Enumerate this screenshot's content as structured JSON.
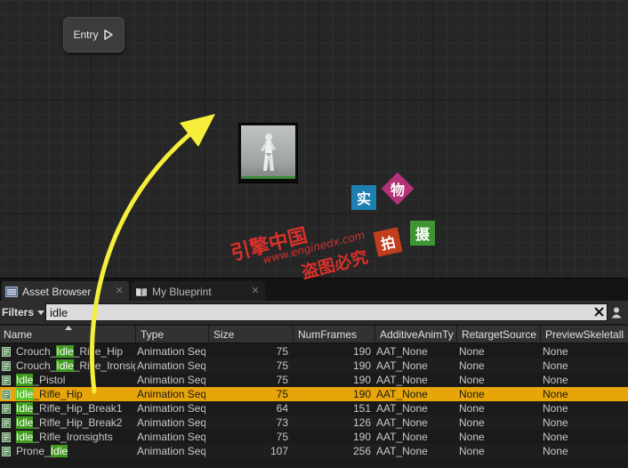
{
  "graph": {
    "entry_label": "Entry"
  },
  "watermark": {
    "sq1": "实",
    "sq2": "物",
    "sq3": "拍",
    "sq4": "摄",
    "line1": "引擎中国",
    "line2": "www.enginedx.com",
    "line3": "盗图必究"
  },
  "tabs": {
    "asset_browser": "Asset Browser",
    "my_blueprint": "My Blueprint",
    "close_glyph": "✕"
  },
  "filter": {
    "label": "Filters",
    "search_value": "idle"
  },
  "columns": [
    "Name",
    "Type",
    "Size",
    "NumFrames",
    "AdditiveAnimTy",
    "RetargetSource",
    "PreviewSkeletall"
  ],
  "rows": [
    {
      "pre": "Crouch_",
      "hl": "Idle",
      "post": "_Rifle_Hip",
      "type": "Animation Seq",
      "size": "75",
      "frames": "190",
      "additive": "AAT_None",
      "retarget": "None",
      "preview": "None",
      "selected": false
    },
    {
      "pre": "Crouch_",
      "hl": "Idle",
      "post": "_Rifle_Ironsig",
      "type": "Animation Seq",
      "size": "75",
      "frames": "190",
      "additive": "AAT_None",
      "retarget": "None",
      "preview": "None",
      "selected": false
    },
    {
      "pre": "",
      "hl": "Idle",
      "post": "_Pistol",
      "type": "Animation Seq",
      "size": "75",
      "frames": "190",
      "additive": "AAT_None",
      "retarget": "None",
      "preview": "None",
      "selected": false
    },
    {
      "pre": "",
      "hl": "Idle",
      "post": "_Rifle_Hip",
      "type": "Animation Seq",
      "size": "75",
      "frames": "190",
      "additive": "AAT_None",
      "retarget": "None",
      "preview": "None",
      "selected": true
    },
    {
      "pre": "",
      "hl": "Idle",
      "post": "_Rifle_Hip_Break1",
      "type": "Animation Seq",
      "size": "64",
      "frames": "151",
      "additive": "AAT_None",
      "retarget": "None",
      "preview": "None",
      "selected": false
    },
    {
      "pre": "",
      "hl": "Idle",
      "post": "_Rifle_Hip_Break2",
      "type": "Animation Seq",
      "size": "73",
      "frames": "126",
      "additive": "AAT_None",
      "retarget": "None",
      "preview": "None",
      "selected": false
    },
    {
      "pre": "",
      "hl": "Idle",
      "post": "_Rifle_Ironsights",
      "type": "Animation Seq",
      "size": "75",
      "frames": "190",
      "additive": "AAT_None",
      "retarget": "None",
      "preview": "None",
      "selected": false
    },
    {
      "pre": "Prone_",
      "hl": "Idle",
      "post": "",
      "type": "Animation Seq",
      "size": "107",
      "frames": "256",
      "additive": "AAT_None",
      "retarget": "None",
      "preview": "None",
      "selected": false
    }
  ],
  "colors": {
    "selection": "#e8a50a",
    "highlight": "#3f9a1e",
    "arrow": "#f5ee3a"
  }
}
